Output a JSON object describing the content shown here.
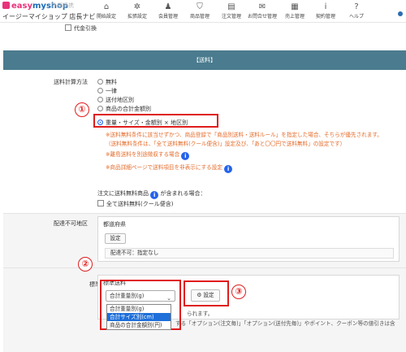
{
  "app": {
    "logo_prefix": "easy",
    "logo_suffix": "myshop",
    "shop_name": "イージーマイショップ",
    "shop_nav": "店長ナビ",
    "faded_label": "外部連携"
  },
  "nav": [
    {
      "label": "開始設定",
      "icon": "house-icon",
      "glyph": "⌂"
    },
    {
      "label": "拡張設定",
      "icon": "gear-icon",
      "glyph": "✲"
    },
    {
      "label": "会員管理",
      "icon": "person-icon",
      "glyph": "♟"
    },
    {
      "label": "商品管理",
      "icon": "shirt-icon",
      "glyph": "⛉"
    },
    {
      "label": "注文管理",
      "icon": "document-icon",
      "glyph": "▤"
    },
    {
      "label": "お問合せ管理",
      "icon": "mail-icon",
      "glyph": "✉"
    },
    {
      "label": "売上管理",
      "icon": "table-icon",
      "glyph": "▦"
    },
    {
      "label": "契約管理",
      "icon": "info-icon",
      "glyph": "i"
    },
    {
      "label": "ヘルプ",
      "icon": "help-icon",
      "glyph": "?"
    }
  ],
  "cod_label": "代金引換",
  "section_title": "【送料】",
  "shipping_method": {
    "label": "送料計算方法",
    "options": [
      "無料",
      "一律",
      "送付地区別",
      "商品の合計金額別",
      "重量・サイズ・金額別 × 地区別"
    ],
    "selected_index": 4,
    "notes": [
      "※送料無料条件に該当せずかつ、商品登録で「商品別送料・送料ルール」を指定した場合、そちらが優先されます。",
      "（送料無料条件は、「全て送料無料(クール便含)」設定及び、「あと〇〇円で送料無料」の設定です）",
      "※離島送料を別途徴収する場合",
      "※商品詳細ページで送料項目を非表示にする設定"
    ]
  },
  "free_item": {
    "prefix": "注文に送料無料商品",
    "suffix": "が含まれる場合：",
    "checkbox_label": "全て送料無料(クール便含)"
  },
  "undeliverable": {
    "label": "配達不可地区",
    "fieldset_title": "都道府県",
    "button": "設定",
    "value": "配達不可：指定なし"
  },
  "standard": {
    "label": "標準送料",
    "fieldset_title": "標準送料",
    "selected": "合計重量別(g)",
    "options": [
      "合計重量別(g)",
      "合計サイズ別(cm)",
      "商品の合計金額別(円)"
    ],
    "highlighted_index": 1,
    "settings_button": "設定",
    "hint1": "られます。",
    "hint2": "する「オプション(注文毎)」「オプション(送付先毎)」やポイント、クーポン等の値引きは含"
  },
  "annotations": [
    "①",
    "②",
    "③"
  ],
  "colors": {
    "annotation": "#e01c1c",
    "header_band": "#4a7b8e",
    "note": "#e46b2a",
    "selection": "#1e6fd9",
    "brand": "#e8327c"
  }
}
